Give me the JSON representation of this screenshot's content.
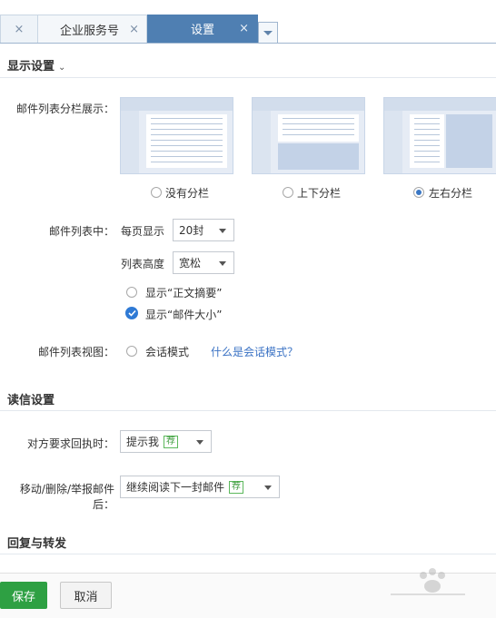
{
  "tabs": [
    {
      "label": "",
      "close": "×"
    },
    {
      "label": "企业服务号",
      "close": "×"
    },
    {
      "label": "设置",
      "close": "×",
      "active": true
    }
  ],
  "display_settings": {
    "title": "显示设置",
    "chevron": "⌄",
    "split_label": "邮件列表分栏展示：",
    "split_options": [
      {
        "label": "没有分栏",
        "selected": false
      },
      {
        "label": "上下分栏",
        "selected": false
      },
      {
        "label": "左右分栏",
        "selected": true
      }
    ],
    "list_label": "邮件列表中：",
    "per_page_label": "每页显示",
    "per_page_value": "20封",
    "height_label": "列表高度",
    "height_value": "宽松",
    "show_summary": {
      "label": "显示“正文摘要”",
      "checked": false
    },
    "show_size": {
      "label": "显示“邮件大小”",
      "checked": true
    },
    "view_label": "邮件列表视图：",
    "conversation_mode": {
      "label": "会话模式",
      "checked": false
    },
    "conversation_link": "什么是会话模式？"
  },
  "read_settings": {
    "title": "读信设置",
    "receipt_label": "对方要求回执时：",
    "receipt_value": "提示我",
    "receipt_tag": "荐",
    "after_action_label": "移动/删除/举报邮件后：",
    "after_action_value": "继续阅读下一封邮件",
    "after_action_tag": "荐"
  },
  "reply_forward": {
    "title": "回复与转发"
  },
  "footer": {
    "save": "保存",
    "cancel": "取消"
  },
  "colors": {
    "active_tab": "#4f7fb2",
    "save_button": "#2ea043",
    "link": "#3a72c4",
    "checked": "#2f7ad5"
  }
}
